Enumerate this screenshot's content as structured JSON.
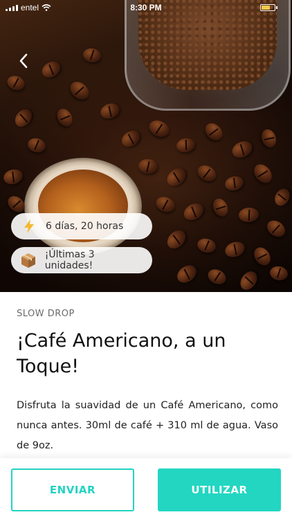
{
  "status_bar": {
    "carrier": "entel",
    "time": "8:30 PM"
  },
  "hero": {
    "time_left": "6 días, 20 horas",
    "stock": "¡Últimas 3 unidades!",
    "icons": {
      "time_left": "lightning-icon",
      "stock": "package-box-icon",
      "back": "chevron-left-icon"
    }
  },
  "product": {
    "category": "SLOW DROP",
    "title": "¡Café Americano, a un Toque!",
    "description": "Disfruta la suavidad de un Café Americano, como nunca antes. 30ml de café + 310 ml de agua. Vaso de 9oz."
  },
  "actions": {
    "send_label": "ENVIAR",
    "use_label": "UTILIZAR"
  },
  "colors": {
    "accent": "#22D6C2",
    "lightning": "#F5B82E"
  }
}
